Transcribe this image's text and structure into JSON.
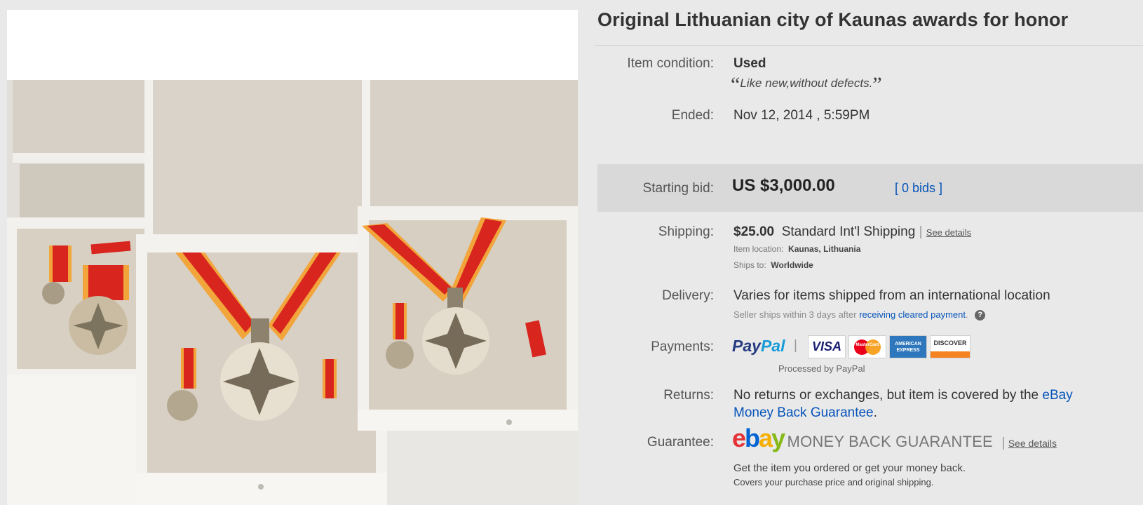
{
  "listing": {
    "title": "Original Lithuanian city of Kaunas awards for honor",
    "condition_label": "Item condition:",
    "condition_value": "Used",
    "condition_note": "Like new,without defects.",
    "ended_label": "Ended:",
    "ended_value": "Nov 12, 2014 , 5:59PM"
  },
  "bid": {
    "label": "Starting bid:",
    "amount": "US $3,000.00",
    "bids_link": "[ 0 bids ]"
  },
  "shipping": {
    "label": "Shipping:",
    "cost": "$25.00",
    "method": "Standard Int'l Shipping",
    "separator": "|",
    "details_link": "See details",
    "item_location_label": "Item location:",
    "item_location_value": "Kaunas, Lithuania",
    "ships_to_label": "Ships to:",
    "ships_to_value": "Worldwide"
  },
  "delivery": {
    "label": "Delivery:",
    "value": "Varies for items shipped from an international location",
    "note_prefix": "Seller ships within 3 days after",
    "note_link": "receiving cleared payment",
    "note_suffix": "."
  },
  "payments": {
    "label": "Payments:",
    "paypal_part1": "Pay",
    "paypal_part2": "Pal",
    "separator": "|",
    "cards": [
      "VISA",
      "MasterCard",
      "AMERICAN EXPRESS",
      "DISCOVER"
    ],
    "processed_by": "Processed by PayPal"
  },
  "returns": {
    "label": "Returns:",
    "text": "No returns or exchanges, but item is covered by the",
    "link_line1": "eBay",
    "link_line2": "Money Back Guarantee",
    "suffix": "."
  },
  "guarantee": {
    "label": "Guarantee:",
    "ebay_e": "e",
    "ebay_b": "b",
    "ebay_a": "a",
    "ebay_y": "y",
    "mbg": "MONEY BACK GUARANTEE",
    "separator": "|",
    "details_link": "See details",
    "line1": "Get the item you ordered or get your money back.",
    "line2": "Covers your purchase price and original shipping."
  },
  "colors": {
    "paypal_dark": "#253b80",
    "paypal_light": "#179bd7",
    "link_blue": "#0654ba",
    "ribbon_red": "#d8261f",
    "ribbon_orange": "#f2a53a"
  }
}
